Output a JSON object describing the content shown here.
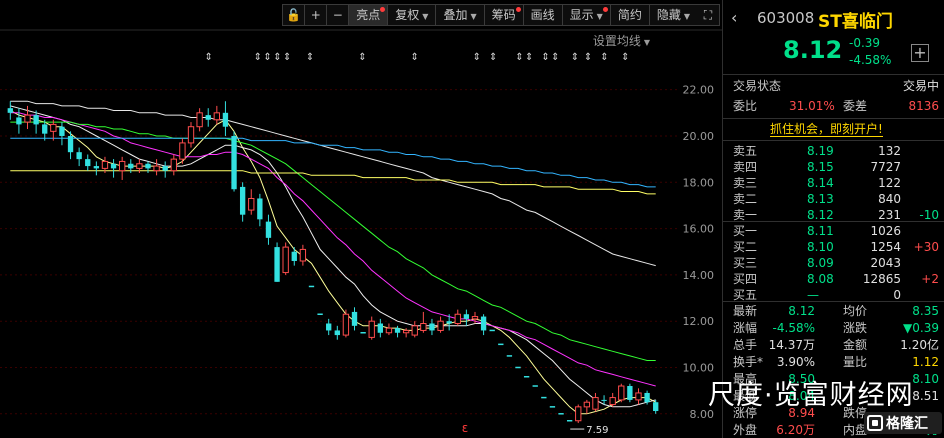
{
  "toolbar": {
    "buttons": [
      {
        "label": "亮点",
        "dot": true,
        "caret": false,
        "active": true
      },
      {
        "label": "复权",
        "dot": false,
        "caret": true,
        "active": false
      },
      {
        "label": "叠加",
        "dot": false,
        "caret": true,
        "active": false
      },
      {
        "label": "筹码",
        "dot": true,
        "caret": false,
        "active": false
      },
      {
        "label": "画线",
        "dot": false,
        "caret": false,
        "active": false
      },
      {
        "label": "显示",
        "dot": true,
        "caret": true,
        "active": false
      },
      {
        "label": "简约",
        "dot": false,
        "caret": false,
        "active": false
      },
      {
        "label": "隐藏",
        "dot": false,
        "caret": true,
        "active": false
      }
    ],
    "lock_icon": "🔓",
    "plus_label": "+",
    "minus_label": "−",
    "expand_icon": "⛶"
  },
  "ma_settings_label": "设置均线",
  "chart_data": {
    "type": "candlestick",
    "y_ticks": [
      "22.00",
      "20.00",
      "18.00",
      "16.00",
      "14.00",
      "12.00",
      "10.00",
      "8.00"
    ],
    "ylim": [
      7.3,
      23.8
    ],
    "min_label": "7.59",
    "grid": true,
    "highlight_marks": 14,
    "candles": [
      {
        "o": 21.2,
        "c": 21.0,
        "h": 21.5,
        "l": 20.7
      },
      {
        "o": 20.8,
        "c": 20.5,
        "h": 21.2,
        "l": 20.1
      },
      {
        "o": 20.6,
        "c": 20.9,
        "h": 21.3,
        "l": 20.3
      },
      {
        "o": 20.9,
        "c": 20.5,
        "h": 21.1,
        "l": 20.1
      },
      {
        "o": 20.5,
        "c": 20.1,
        "h": 20.7,
        "l": 19.8
      },
      {
        "o": 20.2,
        "c": 20.5,
        "h": 20.7,
        "l": 19.8
      },
      {
        "o": 20.4,
        "c": 20.0,
        "h": 20.6,
        "l": 19.6
      },
      {
        "o": 20.0,
        "c": 19.3,
        "h": 20.2,
        "l": 19.0
      },
      {
        "o": 19.3,
        "c": 19.0,
        "h": 19.5,
        "l": 18.7
      },
      {
        "o": 19.0,
        "c": 18.7,
        "h": 19.2,
        "l": 18.5
      },
      {
        "o": 18.7,
        "c": 18.6,
        "h": 18.9,
        "l": 18.3
      },
      {
        "o": 18.6,
        "c": 18.9,
        "h": 19.1,
        "l": 18.4
      },
      {
        "o": 18.8,
        "c": 18.6,
        "h": 19.0,
        "l": 18.2
      },
      {
        "o": 18.5,
        "c": 18.9,
        "h": 19.1,
        "l": 18.1
      },
      {
        "o": 18.8,
        "c": 18.6,
        "h": 19.0,
        "l": 18.4
      },
      {
        "o": 18.6,
        "c": 18.8,
        "h": 19.0,
        "l": 18.4
      },
      {
        "o": 18.8,
        "c": 18.6,
        "h": 18.9,
        "l": 18.4
      },
      {
        "o": 18.5,
        "c": 18.7,
        "h": 19.0,
        "l": 18.3
      },
      {
        "o": 18.7,
        "c": 18.5,
        "h": 18.9,
        "l": 18.2
      },
      {
        "o": 18.5,
        "c": 19.0,
        "h": 19.2,
        "l": 18.3
      },
      {
        "o": 19.0,
        "c": 19.7,
        "h": 19.9,
        "l": 18.8
      },
      {
        "o": 19.7,
        "c": 20.4,
        "h": 20.6,
        "l": 19.5
      },
      {
        "o": 20.4,
        "c": 21.0,
        "h": 21.2,
        "l": 20.2
      },
      {
        "o": 20.9,
        "c": 20.7,
        "h": 21.2,
        "l": 20.4
      },
      {
        "o": 20.7,
        "c": 21.0,
        "h": 21.3,
        "l": 20.5
      },
      {
        "o": 21.0,
        "c": 20.4,
        "h": 21.5,
        "l": 20.0
      },
      {
        "o": 20.0,
        "c": 17.7,
        "h": 20.2,
        "l": 17.6
      },
      {
        "o": 17.8,
        "c": 16.6,
        "h": 18.0,
        "l": 16.3
      },
      {
        "o": 16.8,
        "c": 17.3,
        "h": 17.7,
        "l": 16.6
      },
      {
        "o": 17.3,
        "c": 16.4,
        "h": 17.5,
        "l": 16.1
      },
      {
        "o": 16.3,
        "c": 15.6,
        "h": 16.6,
        "l": 15.3
      },
      {
        "o": 15.2,
        "c": 13.7,
        "h": 15.4,
        "l": 13.7
      },
      {
        "o": 14.1,
        "c": 15.2,
        "h": 15.4,
        "l": 14.0
      },
      {
        "o": 15.0,
        "c": 14.6,
        "h": 15.2,
        "l": 14.4
      },
      {
        "o": 14.6,
        "c": 15.1,
        "h": 15.3,
        "l": 14.4
      },
      {
        "o": 13.5,
        "c": 13.5,
        "h": 13.5,
        "l": 13.5
      },
      {
        "o": 12.3,
        "c": 12.3,
        "h": 12.3,
        "l": 12.3
      },
      {
        "o": 11.9,
        "c": 11.6,
        "h": 12.1,
        "l": 11.4
      },
      {
        "o": 11.6,
        "c": 11.4,
        "h": 11.8,
        "l": 11.2
      },
      {
        "o": 11.4,
        "c": 12.3,
        "h": 12.5,
        "l": 11.3
      },
      {
        "o": 12.4,
        "c": 11.8,
        "h": 12.6,
        "l": 11.6
      },
      {
        "o": 11.5,
        "c": 11.5,
        "h": 11.5,
        "l": 11.5
      },
      {
        "o": 11.3,
        "c": 12.0,
        "h": 12.2,
        "l": 11.2
      },
      {
        "o": 11.9,
        "c": 11.5,
        "h": 12.1,
        "l": 11.3
      },
      {
        "o": 11.5,
        "c": 11.7,
        "h": 11.9,
        "l": 11.4
      },
      {
        "o": 11.7,
        "c": 11.5,
        "h": 11.8,
        "l": 11.3
      },
      {
        "o": 11.5,
        "c": 11.6,
        "h": 11.7,
        "l": 11.3
      },
      {
        "o": 11.4,
        "c": 11.8,
        "h": 12.0,
        "l": 11.3
      },
      {
        "o": 11.6,
        "c": 11.9,
        "h": 12.4,
        "l": 11.5
      },
      {
        "o": 11.9,
        "c": 11.6,
        "h": 12.1,
        "l": 11.4
      },
      {
        "o": 11.6,
        "c": 12.0,
        "h": 12.2,
        "l": 11.5
      },
      {
        "o": 12.0,
        "c": 11.9,
        "h": 12.3,
        "l": 11.6
      },
      {
        "o": 11.9,
        "c": 12.3,
        "h": 12.5,
        "l": 11.8
      },
      {
        "o": 12.3,
        "c": 12.1,
        "h": 12.5,
        "l": 11.8
      },
      {
        "o": 12.1,
        "c": 12.2,
        "h": 12.4,
        "l": 11.9
      },
      {
        "o": 12.2,
        "c": 11.6,
        "h": 12.3,
        "l": 11.4
      },
      {
        "o": 11.6,
        "c": 11.6,
        "h": 11.6,
        "l": 11.6
      },
      {
        "o": 11.0,
        "c": 11.0,
        "h": 11.0,
        "l": 11.0
      },
      {
        "o": 10.5,
        "c": 10.5,
        "h": 10.5,
        "l": 10.5
      },
      {
        "o": 10.0,
        "c": 10.0,
        "h": 10.0,
        "l": 10.0
      },
      {
        "o": 9.6,
        "c": 9.6,
        "h": 9.6,
        "l": 9.6
      },
      {
        "o": 9.2,
        "c": 9.2,
        "h": 9.2,
        "l": 9.2
      },
      {
        "o": 8.7,
        "c": 8.7,
        "h": 8.7,
        "l": 8.7
      },
      {
        "o": 8.3,
        "c": 8.3,
        "h": 8.3,
        "l": 8.3
      },
      {
        "o": 8.0,
        "c": 8.0,
        "h": 8.0,
        "l": 8.0
      },
      {
        "o": 7.7,
        "c": 7.7,
        "h": 7.7,
        "l": 7.7
      },
      {
        "o": 7.7,
        "c": 8.3,
        "h": 8.4,
        "l": 7.6
      },
      {
        "o": 8.3,
        "c": 8.5,
        "h": 8.6,
        "l": 8.0
      },
      {
        "o": 8.2,
        "c": 8.7,
        "h": 8.9,
        "l": 8.1
      },
      {
        "o": 8.6,
        "c": 8.6,
        "h": 8.8,
        "l": 8.4
      },
      {
        "o": 8.4,
        "c": 8.7,
        "h": 8.9,
        "l": 8.3
      },
      {
        "o": 8.6,
        "c": 9.2,
        "h": 9.3,
        "l": 8.5
      },
      {
        "o": 9.2,
        "c": 8.6,
        "h": 9.3,
        "l": 8.5
      },
      {
        "o": 8.6,
        "c": 8.9,
        "h": 9.1,
        "l": 8.4
      },
      {
        "o": 8.9,
        "c": 8.5,
        "h": 9.0,
        "l": 8.4
      },
      {
        "o": 8.5,
        "c": 8.12,
        "h": 8.6,
        "l": 8.0
      }
    ],
    "ma": [
      {
        "name": "MA5",
        "color": "#ffff99",
        "values": [
          21.1,
          20.9,
          20.8,
          20.7,
          20.6,
          20.4,
          20.4,
          20.1,
          19.8,
          19.5,
          19.1,
          18.9,
          18.8,
          18.7,
          18.7,
          18.7,
          18.7,
          18.7,
          18.6,
          18.7,
          18.9,
          19.3,
          19.7,
          20.1,
          20.5,
          20.7,
          20.2,
          19.5,
          18.9,
          18.2,
          17.2,
          16.1,
          15.6,
          15.1,
          14.8,
          14.5,
          13.9,
          13.3,
          12.8,
          12.3,
          12.0,
          11.8,
          11.8,
          11.8,
          11.7,
          11.7,
          11.6,
          11.6,
          11.7,
          11.7,
          11.8,
          11.9,
          12.0,
          12.0,
          12.1,
          12.0,
          11.8,
          11.6,
          11.3,
          10.9,
          10.5,
          10.0,
          9.5,
          9.1,
          8.7,
          8.3,
          8.0,
          8.0,
          8.1,
          8.2,
          8.4,
          8.6,
          8.7,
          8.7,
          8.7,
          8.5
        ]
      },
      {
        "name": "MA10",
        "color": "#f0f0f0",
        "values": [
          21.3,
          21.2,
          21.1,
          21.0,
          20.9,
          20.8,
          20.7,
          20.5,
          20.4,
          20.2,
          20.0,
          19.8,
          19.6,
          19.4,
          19.2,
          19.0,
          18.9,
          18.8,
          18.7,
          18.7,
          18.7,
          18.8,
          19.0,
          19.2,
          19.4,
          19.6,
          19.6,
          19.5,
          19.4,
          19.2,
          18.9,
          18.4,
          17.8,
          17.1,
          16.5,
          15.8,
          15.1,
          14.7,
          14.3,
          13.9,
          13.6,
          13.1,
          12.7,
          12.4,
          12.2,
          12.0,
          11.9,
          11.8,
          11.8,
          11.8,
          11.8,
          11.8,
          11.8,
          11.8,
          11.9,
          11.9,
          11.8,
          11.7,
          11.6,
          11.4,
          11.2,
          10.9,
          10.6,
          10.3,
          9.9,
          9.5,
          9.2,
          8.9,
          8.6,
          8.4,
          8.3,
          8.3,
          8.3,
          8.4,
          8.5,
          8.6
        ]
      },
      {
        "name": "MA20",
        "color": "#ff33ff",
        "values": [
          21.0,
          21.0,
          20.9,
          20.9,
          20.8,
          20.8,
          20.7,
          20.6,
          20.5,
          20.4,
          20.3,
          20.2,
          20.0,
          19.9,
          19.7,
          19.6,
          19.5,
          19.4,
          19.3,
          19.2,
          19.1,
          19.1,
          19.1,
          19.2,
          19.2,
          19.3,
          19.3,
          19.2,
          19.0,
          18.8,
          18.6,
          18.2,
          17.9,
          17.5,
          17.2,
          16.8,
          16.4,
          16.0,
          15.6,
          15.3,
          14.9,
          14.6,
          14.2,
          13.9,
          13.6,
          13.3,
          13.0,
          12.8,
          12.6,
          12.4,
          12.3,
          12.2,
          12.1,
          12.1,
          12.0,
          11.9,
          11.8,
          11.7,
          11.6,
          11.5,
          11.3,
          11.2,
          11.0,
          10.8,
          10.6,
          10.4,
          10.2,
          10.1,
          9.9,
          9.8,
          9.7,
          9.6,
          9.5,
          9.4,
          9.3,
          9.2
        ]
      },
      {
        "name": "MA30",
        "color": "#33ff33",
        "values": [
          20.6,
          20.6,
          20.6,
          20.6,
          20.6,
          20.6,
          20.6,
          20.6,
          20.5,
          20.5,
          20.4,
          20.4,
          20.3,
          20.3,
          20.2,
          20.1,
          20.1,
          20.0,
          20.0,
          19.9,
          19.9,
          19.9,
          19.9,
          19.9,
          19.9,
          19.9,
          19.8,
          19.7,
          19.6,
          19.4,
          19.2,
          19.0,
          18.8,
          18.5,
          18.2,
          17.9,
          17.6,
          17.3,
          17.0,
          16.7,
          16.4,
          16.1,
          15.8,
          15.5,
          15.2,
          15.0,
          14.7,
          14.5,
          14.3,
          14.0,
          13.8,
          13.6,
          13.4,
          13.3,
          13.1,
          12.9,
          12.7,
          12.6,
          12.4,
          12.2,
          12.0,
          11.9,
          11.7,
          11.5,
          11.4,
          11.2,
          11.1,
          11.0,
          10.9,
          10.8,
          10.7,
          10.6,
          10.5,
          10.4,
          10.3,
          10.3
        ]
      },
      {
        "name": "MA60",
        "color": "#e8e8e8",
        "values": [
          21.5,
          21.5,
          21.5,
          21.4,
          21.4,
          21.4,
          21.3,
          21.3,
          21.3,
          21.2,
          21.2,
          21.2,
          21.1,
          21.1,
          21.1,
          21.0,
          21.0,
          21.0,
          20.9,
          20.9,
          20.9,
          20.8,
          20.8,
          20.8,
          20.7,
          20.7,
          20.6,
          20.5,
          20.4,
          20.3,
          20.2,
          20.1,
          20.0,
          19.9,
          19.8,
          19.7,
          19.6,
          19.5,
          19.4,
          19.3,
          19.2,
          19.1,
          19.0,
          18.9,
          18.8,
          18.7,
          18.6,
          18.5,
          18.4,
          18.2,
          18.1,
          18.0,
          17.9,
          17.8,
          17.7,
          17.6,
          17.5,
          17.3,
          17.2,
          17.0,
          16.8,
          16.7,
          16.5,
          16.3,
          16.1,
          15.9,
          15.7,
          15.5,
          15.3,
          15.1,
          14.9,
          14.8,
          14.7,
          14.6,
          14.5,
          14.4
        ]
      },
      {
        "name": "MA120",
        "color": "#33b5ff",
        "values": [
          19.9,
          19.9,
          19.9,
          19.9,
          19.9,
          19.9,
          19.9,
          19.9,
          19.9,
          19.9,
          19.9,
          19.9,
          19.9,
          19.9,
          19.9,
          19.9,
          19.9,
          19.9,
          19.9,
          19.9,
          19.9,
          19.9,
          19.9,
          19.9,
          19.9,
          19.9,
          19.9,
          19.9,
          19.8,
          19.8,
          19.8,
          19.8,
          19.8,
          19.7,
          19.7,
          19.7,
          19.6,
          19.6,
          19.6,
          19.5,
          19.5,
          19.4,
          19.4,
          19.4,
          19.3,
          19.3,
          19.2,
          19.2,
          19.1,
          19.1,
          19.0,
          19.0,
          18.9,
          18.9,
          18.8,
          18.8,
          18.7,
          18.7,
          18.6,
          18.6,
          18.5,
          18.5,
          18.4,
          18.4,
          18.3,
          18.3,
          18.2,
          18.2,
          18.1,
          18.1,
          18.0,
          18.0,
          17.9,
          17.9,
          17.8,
          17.8
        ]
      },
      {
        "name": "MA250",
        "color": "#ffff66",
        "values": [
          18.5,
          18.5,
          18.5,
          18.5,
          18.5,
          18.5,
          18.5,
          18.5,
          18.5,
          18.5,
          18.5,
          18.5,
          18.5,
          18.5,
          18.5,
          18.5,
          18.5,
          18.5,
          18.5,
          18.5,
          18.5,
          18.5,
          18.5,
          18.5,
          18.5,
          18.5,
          18.5,
          18.5,
          18.4,
          18.4,
          18.4,
          18.4,
          18.4,
          18.4,
          18.4,
          18.3,
          18.3,
          18.3,
          18.3,
          18.3,
          18.3,
          18.2,
          18.2,
          18.2,
          18.2,
          18.2,
          18.2,
          18.1,
          18.1,
          18.1,
          18.1,
          18.1,
          18.0,
          18.0,
          18.0,
          18.0,
          18.0,
          17.9,
          17.9,
          17.9,
          17.9,
          17.9,
          17.8,
          17.8,
          17.8,
          17.8,
          17.7,
          17.7,
          17.7,
          17.7,
          17.7,
          17.6,
          17.6,
          17.6,
          17.5,
          17.5
        ]
      }
    ]
  },
  "stock": {
    "code": "603008",
    "name": "ST喜临门",
    "price": "8.12",
    "change": "-0.39",
    "change_pct": "-4.58%",
    "add_label": "+"
  },
  "status": {
    "label": "交易状态",
    "value": "交易中",
    "wb_label": "委比",
    "wb_value": "31.01%",
    "wc_label": "委差",
    "wc_value": "8136"
  },
  "promo": "抓住机会，即刻开户!",
  "asks": [
    {
      "label": "卖五",
      "price": "8.19",
      "vol": "132",
      "delta": ""
    },
    {
      "label": "卖四",
      "price": "8.15",
      "vol": "7727",
      "delta": ""
    },
    {
      "label": "卖三",
      "price": "8.14",
      "vol": "122",
      "delta": ""
    },
    {
      "label": "卖二",
      "price": "8.13",
      "vol": "840",
      "delta": ""
    },
    {
      "label": "卖一",
      "price": "8.12",
      "vol": "231",
      "delta": "-10"
    }
  ],
  "bids": [
    {
      "label": "买一",
      "price": "8.11",
      "vol": "1026",
      "delta": ""
    },
    {
      "label": "买二",
      "price": "8.10",
      "vol": "1254",
      "delta": "+30"
    },
    {
      "label": "买三",
      "price": "8.09",
      "vol": "2043",
      "delta": ""
    },
    {
      "label": "买四",
      "price": "8.08",
      "vol": "12865",
      "delta": "+2"
    },
    {
      "label": "买五",
      "price": "—",
      "vol": "0",
      "delta": ""
    }
  ],
  "stats": [
    {
      "l1": "最新",
      "v1": "8.12",
      "c1": "green",
      "l2": "均价",
      "v2": "8.35",
      "c2": "green"
    },
    {
      "l1": "涨幅",
      "v1": "-4.58%",
      "c1": "green",
      "l2": "涨跌",
      "v2": "▼0.39",
      "c2": "green"
    },
    {
      "l1": "总手",
      "v1": "14.37万",
      "c1": "white",
      "l2": "金额",
      "v2": "1.20亿",
      "c2": "white"
    },
    {
      "l1": "换手*",
      "v1": "3.90%",
      "c1": "white",
      "l2": "量比",
      "v2": "1.12",
      "c2": "yellow"
    },
    {
      "l1": "最高",
      "v1": "8.50",
      "c1": "green",
      "l2": "",
      "v2": "8.10",
      "c2": "green"
    },
    {
      "l1": "最低",
      "v1": "8.04",
      "c1": "green",
      "l2": "",
      "v2": "8.51",
      "c2": "white"
    },
    {
      "l1": "涨停",
      "v1": "8.94",
      "c1": "red",
      "l2": "跌停",
      "v2": "",
      "c2": "green"
    },
    {
      "l1": "外盘",
      "v1": "6.20万",
      "c1": "red",
      "l2": "内盘",
      "v2": "8.17万",
      "c2": "green"
    }
  ],
  "watermark": "尺度·览富财经网",
  "gelonghui": "格隆汇"
}
